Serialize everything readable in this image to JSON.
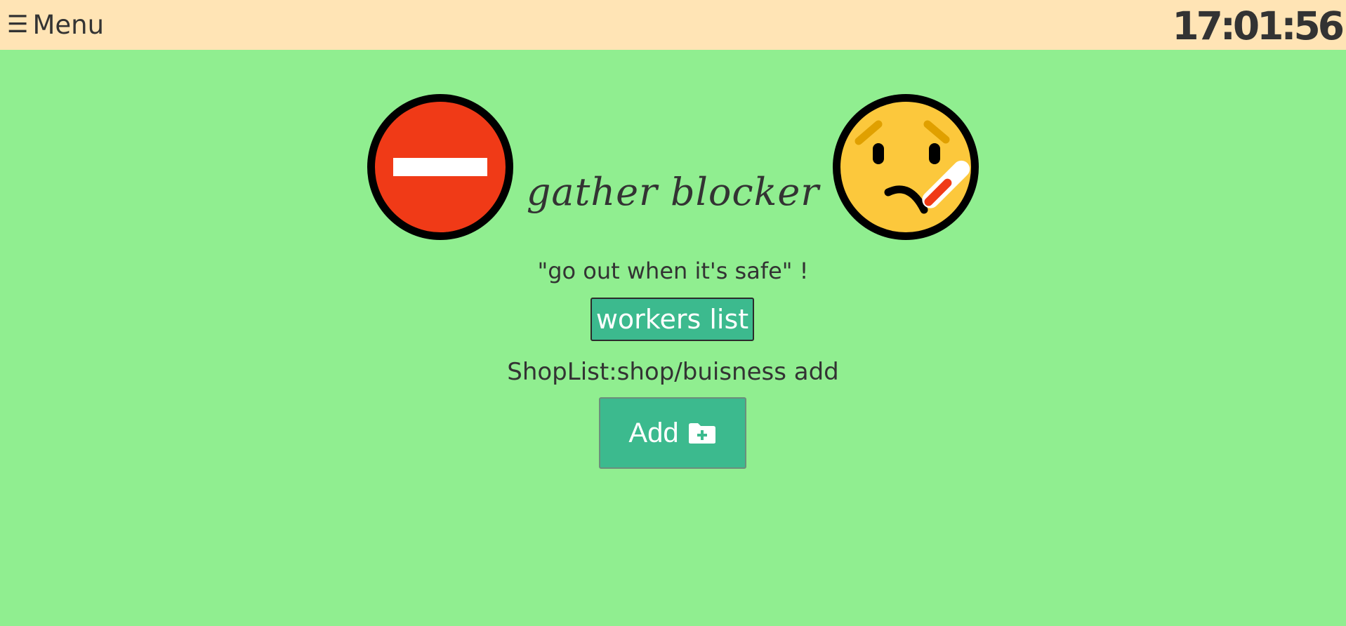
{
  "header": {
    "menu_icon": "☰",
    "menu_label": "Menu",
    "clock": "17:01:56"
  },
  "hero": {
    "left_icon": "no-entry-icon",
    "right_icon": "thermometer-face-icon",
    "title": "gather blocker",
    "slogan": "\"go out when it's safe\" !"
  },
  "actions": {
    "workers_list_label": "workers list",
    "shoplist_label": "ShopList:shop/buisness add",
    "add_label": "Add",
    "add_icon": "folder-plus-icon"
  },
  "colors": {
    "page_background": "#90ee90",
    "topbar_background": "#ffe4b5",
    "button_background": "#3cba8e",
    "text": "#333333",
    "no_entry_red": "#f03a17",
    "face_yellow": "#fcc83c"
  }
}
